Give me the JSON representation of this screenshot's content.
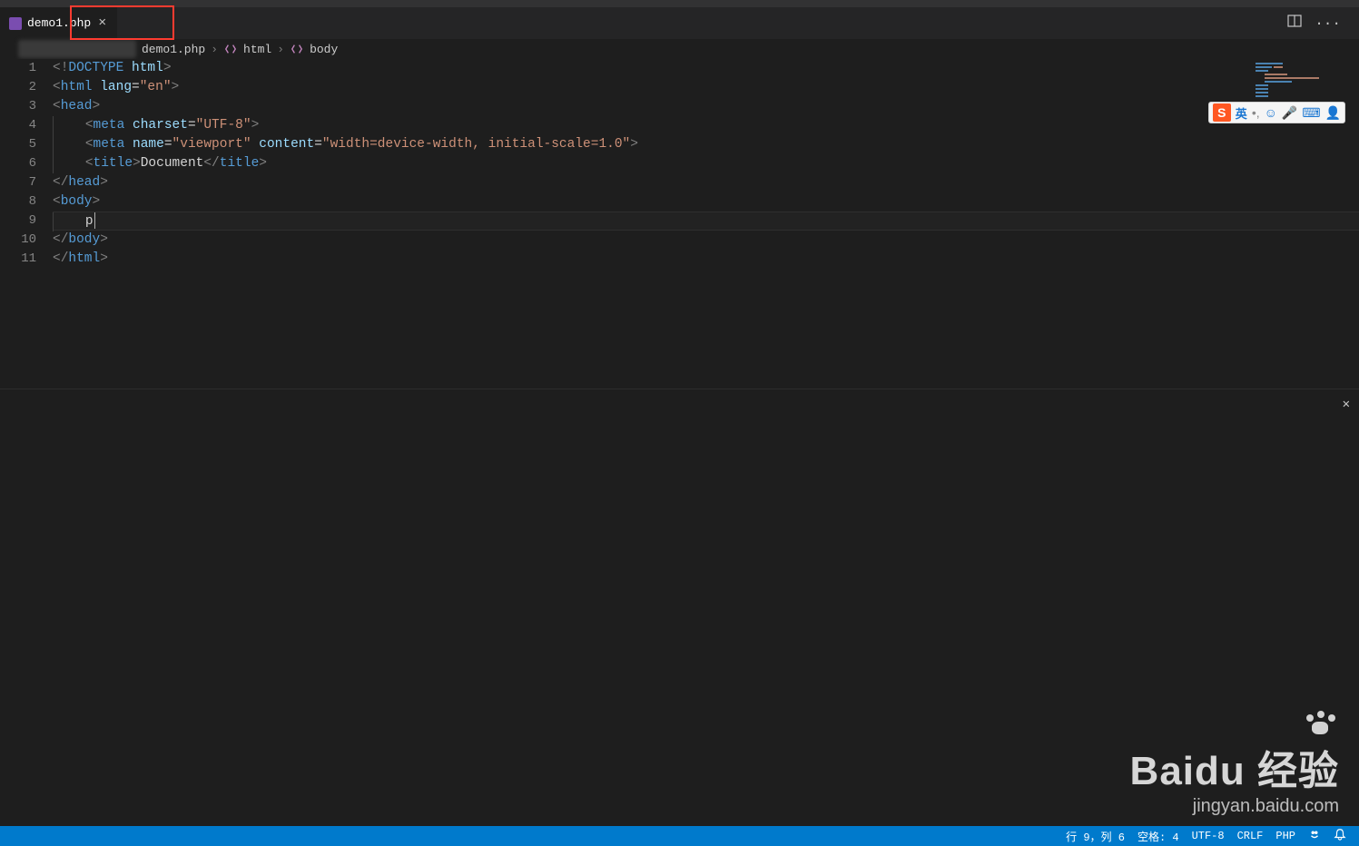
{
  "tab": {
    "filename": "demo1.php",
    "close_label": "×"
  },
  "breadcrumbs": {
    "file": "demo1.php",
    "segments": [
      "html",
      "body"
    ]
  },
  "gutter": [
    "1",
    "2",
    "3",
    "4",
    "5",
    "6",
    "7",
    "8",
    "9",
    "10",
    "11"
  ],
  "code": {
    "line1": "<!DOCTYPE html>",
    "line2_open": "<",
    "line2_tag": "html",
    "line2_attr": " lang",
    "line2_eq": "=",
    "line2_val": "\"en\"",
    "line2_close": ">",
    "line3_open": "<",
    "line3_tag": "head",
    "line3_close": ">",
    "line4_open": "<",
    "line4_tag": "meta",
    "line4_attr": " charset",
    "line4_eq": "=",
    "line4_val": "\"UTF-8\"",
    "line4_close": ">",
    "line5_open": "<",
    "line5_tag": "meta",
    "line5_attr1": " name",
    "line5_eq1": "=",
    "line5_val1": "\"viewport\"",
    "line5_attr2": " content",
    "line5_eq2": "=",
    "line5_val2": "\"width=device-width, initial-scale=1.0\"",
    "line5_close": ">",
    "line6_open": "<",
    "line6_tag": "title",
    "line6_close": ">",
    "line6_text": "Document",
    "line6_copen": "</",
    "line6_ctag": "title",
    "line6_cclose": ">",
    "line7_open": "</",
    "line7_tag": "head",
    "line7_close": ">",
    "line8_open": "<",
    "line8_tag": "body",
    "line8_close": ">",
    "line9_text": "p",
    "line10_open": "</",
    "line10_tag": "body",
    "line10_close": ">",
    "line11_open": "</",
    "line11_tag": "html",
    "line11_close": ">"
  },
  "statusbar": {
    "cursor_pos": "行 9，列 6",
    "spaces": "空格: 4",
    "encoding": "UTF-8",
    "eol": "CRLF",
    "language": "PHP"
  },
  "watermark": {
    "main": "Baidu 经验",
    "sub": "jingyan.baidu.com"
  },
  "ime": {
    "s": "S",
    "lang": "英"
  }
}
